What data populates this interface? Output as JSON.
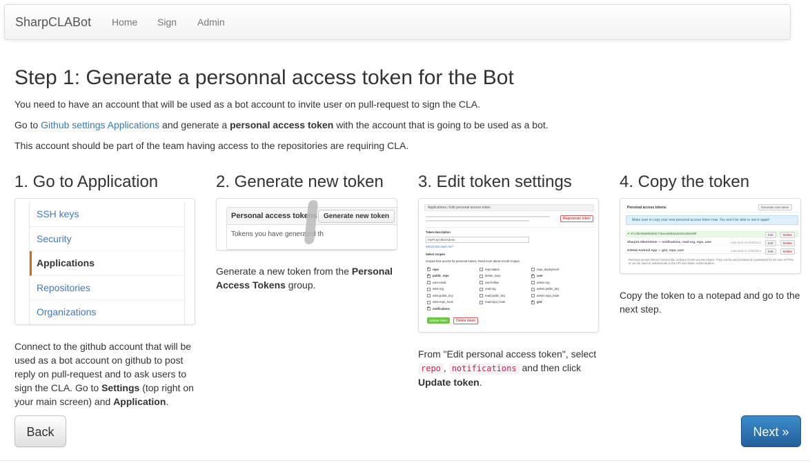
{
  "navbar": {
    "brand": "SharpCLABot",
    "links": [
      "Home",
      "Sign",
      "Admin"
    ]
  },
  "page": {
    "title": "Step 1: Generate a personnal access token for the Bot",
    "p1": "You need to have an account that will be used as a bot account to invite user on pull-request to sign the CLA.",
    "p2_before": "Go to ",
    "p2_link": "Github settings Applications",
    "p2_middle": " and generate a ",
    "p2_bold": "personal access token",
    "p2_after": " with the account that is going to be used as a bot.",
    "p3": "This account should be part of the team having access to the repositories are requiring CLA."
  },
  "steps": [
    {
      "title": "1. Go to Application",
      "menu": [
        "SSH keys",
        "Security",
        "Applications",
        "Repositories",
        "Organizations"
      ],
      "active_menu": "Applications",
      "text_1": "Connect to the github account that will be used as a bot account on github to post reply on pull-request and to ask users to sign the CLA. Go to ",
      "bold_1": "Settings",
      "text_2": " (top right on your main screen) and ",
      "bold_2": "Application",
      "text_3": "."
    },
    {
      "title": "2. Generate new token",
      "box_header": "Personal access tokens",
      "box_button": "Generate new token",
      "box_body": "Tokens you have generated th",
      "text_1": "Generate a new token from the ",
      "bold_1": "Personal Access Tokens",
      "text_2": " group."
    },
    {
      "title": "3. Edit token settings",
      "mini": {
        "breadcrumb": "Applications / Edit personal access token",
        "regen": "Regenerate token",
        "token_desc_label": "Token description",
        "token_desc_value": "MyProjectBotAdmin",
        "whats_this": "What's this token for?",
        "scopes_label": "Select scopes",
        "scopes_help": "Scopes limit access for personal tokens. Read more about OAuth scopes.",
        "scopes": [
          {
            "name": "repo",
            "on": true
          },
          {
            "name": "repo:status",
            "on": false
          },
          {
            "name": "repo_deployment",
            "on": false
          },
          {
            "name": "public_repo",
            "on": true
          },
          {
            "name": "delete_repo",
            "on": false
          },
          {
            "name": "user",
            "on": true
          },
          {
            "name": "user:email",
            "on": false
          },
          {
            "name": "user:follow",
            "on": false
          },
          {
            "name": "admin:org",
            "on": false
          },
          {
            "name": "write:org",
            "on": false
          },
          {
            "name": "read:org",
            "on": false
          },
          {
            "name": "admin:public_key",
            "on": false
          },
          {
            "name": "write:public_key",
            "on": false
          },
          {
            "name": "read:public_key",
            "on": false
          },
          {
            "name": "admin:repo_hook",
            "on": false
          },
          {
            "name": "write:repo_hook",
            "on": false
          },
          {
            "name": "read:repo_hook",
            "on": false
          },
          {
            "name": "gist",
            "on": true
          },
          {
            "name": "notifications",
            "on": true
          }
        ],
        "update_btn": "Update token",
        "delete_btn": "Delete token"
      },
      "text_1": "From \"Edit personal access token\", select",
      "code_1": "repo",
      "sep": ", ",
      "code_2": "notifications",
      "text_2": " and then click",
      "bold_1": "Update token",
      "text_3": "."
    },
    {
      "title": "4. Copy the token",
      "mini": {
        "header": "Personal access tokens",
        "gen_btn": "Generate new token",
        "info": "Make sure to copy your new personal access token now. You won't be able to see it again!",
        "token": "✔ ef c38c08a55b55dc7cbeea6d0a162e5148a0d0f",
        "row1": "SharpCLABotAdmin — notifications, read:org, repo, user",
        "row1_date": "Last used on 9/18/2014",
        "row2": "GitHub Android App — gist, repo, user",
        "row2_date": "Last used on 4/18/2014",
        "edit": "Edit",
        "delete": "Delete",
        "footer": "Personal access tokens function like ordinary OAuth access tokens. They can be used instead of a password for Git over HTTPS, or can be used to authenticate to the API over Basic Authentication."
      },
      "text": "Copy the token to a notepad and go to the next step."
    }
  ],
  "buttons": {
    "back": "Back",
    "next": "Next »"
  }
}
